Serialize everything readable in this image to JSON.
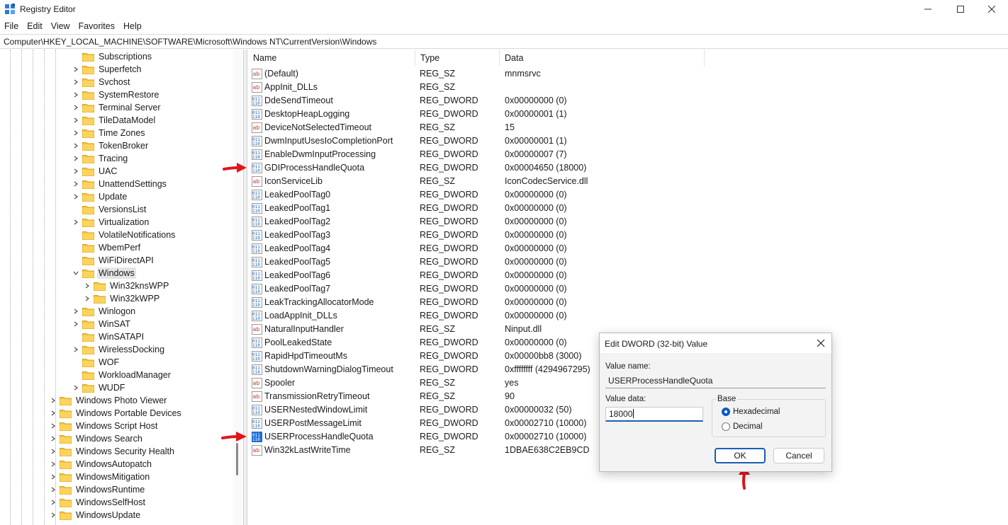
{
  "window": {
    "title": "Registry Editor"
  },
  "menu": [
    "File",
    "Edit",
    "View",
    "Favorites",
    "Help"
  ],
  "address": "Computer\\HKEY_LOCAL_MACHINE\\SOFTWARE\\Microsoft\\Windows NT\\CurrentVersion\\Windows",
  "tree": [
    {
      "label": "Subscriptions",
      "level": 2,
      "expander": "none"
    },
    {
      "label": "Superfetch",
      "level": 2,
      "expander": "collapsed"
    },
    {
      "label": "Svchost",
      "level": 2,
      "expander": "collapsed"
    },
    {
      "label": "SystemRestore",
      "level": 2,
      "expander": "collapsed"
    },
    {
      "label": "Terminal Server",
      "level": 2,
      "expander": "collapsed"
    },
    {
      "label": "TileDataModel",
      "level": 2,
      "expander": "collapsed"
    },
    {
      "label": "Time Zones",
      "level": 2,
      "expander": "collapsed"
    },
    {
      "label": "TokenBroker",
      "level": 2,
      "expander": "collapsed"
    },
    {
      "label": "Tracing",
      "level": 2,
      "expander": "collapsed"
    },
    {
      "label": "UAC",
      "level": 2,
      "expander": "collapsed"
    },
    {
      "label": "UnattendSettings",
      "level": 2,
      "expander": "collapsed"
    },
    {
      "label": "Update",
      "level": 2,
      "expander": "collapsed"
    },
    {
      "label": "VersionsList",
      "level": 2,
      "expander": "none"
    },
    {
      "label": "Virtualization",
      "level": 2,
      "expander": "collapsed"
    },
    {
      "label": "VolatileNotifications",
      "level": 2,
      "expander": "none"
    },
    {
      "label": "WbemPerf",
      "level": 2,
      "expander": "none"
    },
    {
      "label": "WiFiDirectAPI",
      "level": 2,
      "expander": "none"
    },
    {
      "label": "Windows",
      "level": 2,
      "expander": "expanded",
      "selected": true
    },
    {
      "label": "Win32knsWPP",
      "level": 3,
      "expander": "collapsed"
    },
    {
      "label": "Win32kWPP",
      "level": 3,
      "expander": "collapsed"
    },
    {
      "label": "Winlogon",
      "level": 2,
      "expander": "collapsed"
    },
    {
      "label": "WinSAT",
      "level": 2,
      "expander": "collapsed"
    },
    {
      "label": "WinSATAPI",
      "level": 2,
      "expander": "none"
    },
    {
      "label": "WirelessDocking",
      "level": 2,
      "expander": "collapsed"
    },
    {
      "label": "WOF",
      "level": 2,
      "expander": "none"
    },
    {
      "label": "WorkloadManager",
      "level": 2,
      "expander": "none"
    },
    {
      "label": "WUDF",
      "level": 2,
      "expander": "collapsed"
    },
    {
      "label": "Windows Photo Viewer",
      "level": 1,
      "expander": "collapsed"
    },
    {
      "label": "Windows Portable Devices",
      "level": 1,
      "expander": "collapsed"
    },
    {
      "label": "Windows Script Host",
      "level": 1,
      "expander": "collapsed"
    },
    {
      "label": "Windows Search",
      "level": 1,
      "expander": "collapsed"
    },
    {
      "label": "Windows Security Health",
      "level": 1,
      "expander": "collapsed"
    },
    {
      "label": "WindowsAutopatch",
      "level": 1,
      "expander": "collapsed"
    },
    {
      "label": "WindowsMitigation",
      "level": 1,
      "expander": "collapsed"
    },
    {
      "label": "WindowsRuntime",
      "level": 1,
      "expander": "collapsed"
    },
    {
      "label": "WindowsSelfHost",
      "level": 1,
      "expander": "collapsed"
    },
    {
      "label": "WindowsUpdate",
      "level": 1,
      "expander": "collapsed"
    }
  ],
  "columns": {
    "name": "Name",
    "type": "Type",
    "data": "Data"
  },
  "values": [
    {
      "name": "(Default)",
      "type": "REG_SZ",
      "data": "mnmsrvc",
      "icon": "string-value-icon"
    },
    {
      "name": "AppInit_DLLs",
      "type": "REG_SZ",
      "data": "",
      "icon": "string-value-icon"
    },
    {
      "name": "DdeSendTimeout",
      "type": "REG_DWORD",
      "data": "0x00000000 (0)",
      "icon": "binary-value-icon"
    },
    {
      "name": "DesktopHeapLogging",
      "type": "REG_DWORD",
      "data": "0x00000001 (1)",
      "icon": "binary-value-icon"
    },
    {
      "name": "DeviceNotSelectedTimeout",
      "type": "REG_SZ",
      "data": "15",
      "icon": "string-value-icon"
    },
    {
      "name": "DwmInputUsesIoCompletionPort",
      "type": "REG_DWORD",
      "data": "0x00000001 (1)",
      "icon": "binary-value-icon"
    },
    {
      "name": "EnableDwmInputProcessing",
      "type": "REG_DWORD",
      "data": "0x00000007 (7)",
      "icon": "binary-value-icon"
    },
    {
      "name": "GDIProcessHandleQuota",
      "type": "REG_DWORD",
      "data": "0x00004650 (18000)",
      "icon": "binary-value-icon"
    },
    {
      "name": "IconServiceLib",
      "type": "REG_SZ",
      "data": "IconCodecService.dll",
      "icon": "string-value-icon"
    },
    {
      "name": "LeakedPoolTag0",
      "type": "REG_DWORD",
      "data": "0x00000000 (0)",
      "icon": "binary-value-icon"
    },
    {
      "name": "LeakedPoolTag1",
      "type": "REG_DWORD",
      "data": "0x00000000 (0)",
      "icon": "binary-value-icon"
    },
    {
      "name": "LeakedPoolTag2",
      "type": "REG_DWORD",
      "data": "0x00000000 (0)",
      "icon": "binary-value-icon"
    },
    {
      "name": "LeakedPoolTag3",
      "type": "REG_DWORD",
      "data": "0x00000000 (0)",
      "icon": "binary-value-icon"
    },
    {
      "name": "LeakedPoolTag4",
      "type": "REG_DWORD",
      "data": "0x00000000 (0)",
      "icon": "binary-value-icon"
    },
    {
      "name": "LeakedPoolTag5",
      "type": "REG_DWORD",
      "data": "0x00000000 (0)",
      "icon": "binary-value-icon"
    },
    {
      "name": "LeakedPoolTag6",
      "type": "REG_DWORD",
      "data": "0x00000000 (0)",
      "icon": "binary-value-icon"
    },
    {
      "name": "LeakedPoolTag7",
      "type": "REG_DWORD",
      "data": "0x00000000 (0)",
      "icon": "binary-value-icon"
    },
    {
      "name": "LeakTrackingAllocatorMode",
      "type": "REG_DWORD",
      "data": "0x00000000 (0)",
      "icon": "binary-value-icon"
    },
    {
      "name": "LoadAppInit_DLLs",
      "type": "REG_DWORD",
      "data": "0x00000000 (0)",
      "icon": "binary-value-icon"
    },
    {
      "name": "NaturalInputHandler",
      "type": "REG_SZ",
      "data": "Ninput.dll",
      "icon": "string-value-icon"
    },
    {
      "name": "PoolLeakedState",
      "type": "REG_DWORD",
      "data": "0x00000000 (0)",
      "icon": "binary-value-icon"
    },
    {
      "name": "RapidHpdTimeoutMs",
      "type": "REG_DWORD",
      "data": "0x00000bb8 (3000)",
      "icon": "binary-value-icon"
    },
    {
      "name": "ShutdownWarningDialogTimeout",
      "type": "REG_DWORD",
      "data": "0xffffffff (4294967295)",
      "icon": "binary-value-icon"
    },
    {
      "name": "Spooler",
      "type": "REG_SZ",
      "data": "yes",
      "icon": "string-value-icon"
    },
    {
      "name": "TransmissionRetryTimeout",
      "type": "REG_SZ",
      "data": "90",
      "icon": "string-value-icon"
    },
    {
      "name": "USERNestedWindowLimit",
      "type": "REG_DWORD",
      "data": "0x00000032 (50)",
      "icon": "binary-value-icon"
    },
    {
      "name": "USERPostMessageLimit",
      "type": "REG_DWORD",
      "data": "0x00002710 (10000)",
      "icon": "binary-value-icon"
    },
    {
      "name": "USERProcessHandleQuota",
      "type": "REG_DWORD",
      "data": "0x00002710 (10000)",
      "icon": "binary-value-icon",
      "selected": true
    },
    {
      "name": "Win32kLastWriteTime",
      "type": "REG_SZ",
      "data": "1DBAE638C2EB9CD",
      "icon": "string-value-icon"
    }
  ],
  "dialog": {
    "title": "Edit DWORD (32-bit) Value",
    "value_name_label": "Value name:",
    "value_name": "USERProcessHandleQuota",
    "value_data_label": "Value data:",
    "value_data": "18000",
    "base_label": "Base",
    "base_options": [
      "Hexadecimal",
      "Decimal"
    ],
    "base_selected": "Hexadecimal",
    "ok_label": "OK",
    "cancel_label": "Cancel"
  },
  "annotations": {
    "arrow_color": "#e0161b"
  }
}
